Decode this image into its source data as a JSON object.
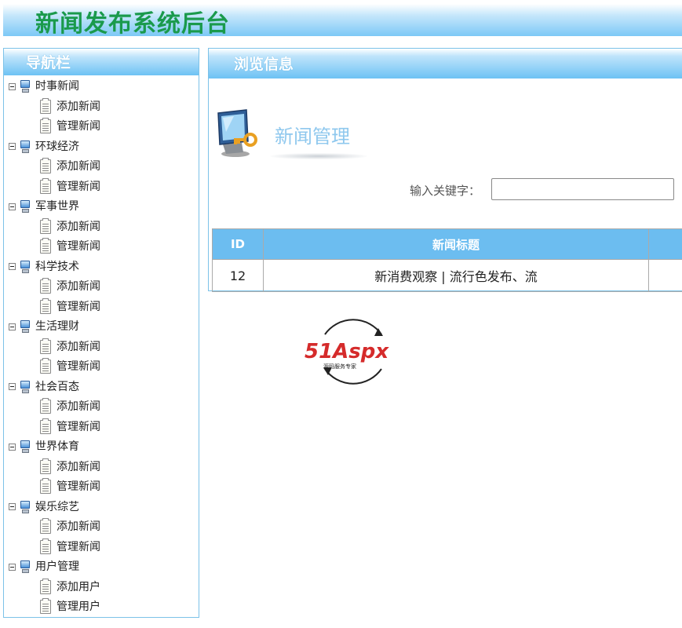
{
  "header": {
    "title": "新闻发布系统后台"
  },
  "sidebar": {
    "title": "导航栏",
    "groups": [
      {
        "label": "时事新闻",
        "items": [
          "添加新闻",
          "管理新闻"
        ]
      },
      {
        "label": "环球经济",
        "items": [
          "添加新闻",
          "管理新闻"
        ]
      },
      {
        "label": "军事世界",
        "items": [
          "添加新闻",
          "管理新闻"
        ]
      },
      {
        "label": "科学技术",
        "items": [
          "添加新闻",
          "管理新闻"
        ]
      },
      {
        "label": "生活理财",
        "items": [
          "添加新闻",
          "管理新闻"
        ]
      },
      {
        "label": "社会百态",
        "items": [
          "添加新闻",
          "管理新闻"
        ]
      },
      {
        "label": "世界体育",
        "items": [
          "添加新闻",
          "管理新闻"
        ]
      },
      {
        "label": "娱乐综艺",
        "items": [
          "添加新闻",
          "管理新闻"
        ]
      },
      {
        "label": "用户管理",
        "items": [
          "添加用户",
          "管理用户"
        ]
      }
    ]
  },
  "main": {
    "title": "浏览信息",
    "section_title": "新闻管理",
    "search": {
      "label": "输入关键字：",
      "value": ""
    },
    "table": {
      "columns": [
        "ID",
        "新闻标题",
        ""
      ],
      "rows": [
        [
          "12",
          "新消费观察 | 流行色发布、流",
          ""
        ]
      ]
    }
  },
  "logo": {
    "text": "51Aspx",
    "subtext": "源码服务专家"
  },
  "colors": {
    "title_green": "#1a9a4c",
    "header_blue": "#6dc2f4",
    "table_head": "#6cbdf0"
  }
}
